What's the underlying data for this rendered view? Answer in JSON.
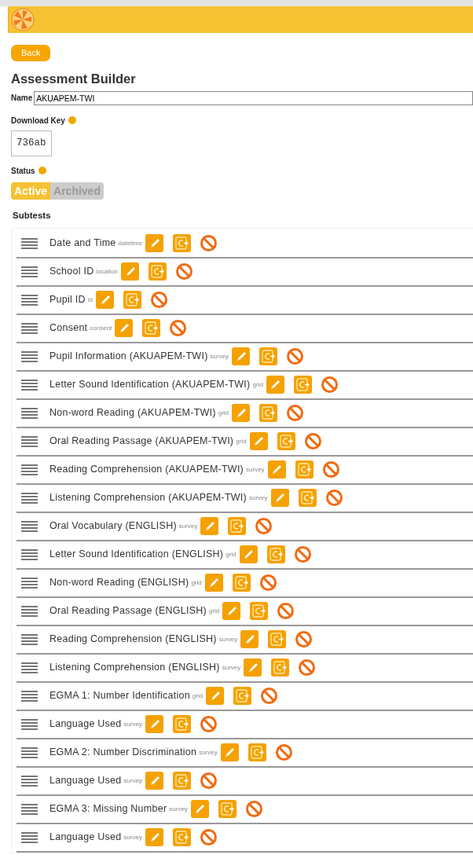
{
  "header": {
    "logo": true
  },
  "back_button": "Back",
  "title": "Assessment Builder",
  "name_field": {
    "label": "Name",
    "value": "AKUAPEM-TWI"
  },
  "download_key": {
    "label": "Download Key",
    "value": "736ab"
  },
  "status": {
    "label": "Status",
    "options": [
      {
        "label": "Active",
        "selected": true
      },
      {
        "label": "Archived",
        "selected": false
      }
    ]
  },
  "subtests_heading": "Subtests",
  "subtests": [
    {
      "name": "Date and Time",
      "type": "datetime"
    },
    {
      "name": "School ID",
      "type": "location"
    },
    {
      "name": "Pupil ID",
      "type": "id"
    },
    {
      "name": "Consent",
      "type": "consent"
    },
    {
      "name": "Pupil Information (AKUAPEM-TWI)",
      "type": "survey"
    },
    {
      "name": "Letter Sound Identification (AKUAPEM-TWI)",
      "type": "grid"
    },
    {
      "name": "Non-word Reading (AKUAPEM-TWI)",
      "type": "grid"
    },
    {
      "name": "Oral Reading Passage (AKUAPEM-TWI)",
      "type": "grid"
    },
    {
      "name": "Reading Comprehension (AKUAPEM-TWI)",
      "type": "survey"
    },
    {
      "name": "Listening Comprehension (AKUAPEM-TWI)",
      "type": "survey"
    },
    {
      "name": "Oral Vocabulary (ENGLISH)",
      "type": "survey"
    },
    {
      "name": "Letter Sound Identification (ENGLISH)",
      "type": "grid"
    },
    {
      "name": "Non-word Reading (ENGLISH)",
      "type": "grid"
    },
    {
      "name": "Oral Reading Passage (ENGLISH)",
      "type": "grid"
    },
    {
      "name": "Reading Comprehension (ENGLISH)",
      "type": "survey"
    },
    {
      "name": "Listening Comprehension (ENGLISH)",
      "type": "survey"
    },
    {
      "name": "EGMA 1: Number Identification",
      "type": "grid"
    },
    {
      "name": "Language Used",
      "type": "survey"
    },
    {
      "name": "EGMA 2: Number Discrimination",
      "type": "survey"
    },
    {
      "name": "Language Used",
      "type": "survey"
    },
    {
      "name": "EGMA 3: Missing Number",
      "type": "survey"
    },
    {
      "name": "Language Used",
      "type": "survey"
    }
  ]
}
